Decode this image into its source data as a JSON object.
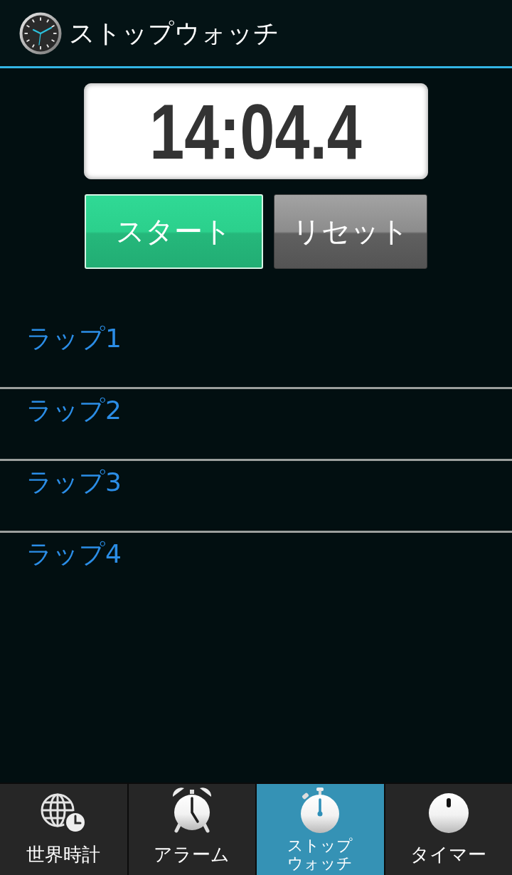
{
  "title_bar": {
    "title": "ストップウォッチ"
  },
  "stopwatch": {
    "time": "14:04.4"
  },
  "buttons": [
    {
      "label": "スタート",
      "kind": "start"
    },
    {
      "label": "リセット",
      "kind": "reset"
    }
  ],
  "laps": [
    {
      "label": "ラップ1"
    },
    {
      "label": "ラップ2"
    },
    {
      "label": "ラップ3"
    },
    {
      "label": "ラップ4"
    }
  ],
  "tabs": [
    {
      "label": "世界時計",
      "kind": "world_clock",
      "selected": false
    },
    {
      "label": "アラーム",
      "kind": "alarm",
      "selected": false
    },
    {
      "label": "ストップウォッチ",
      "kind": "stopwatch",
      "selected": true
    },
    {
      "label": "タイマー",
      "kind": "timer",
      "selected": false
    }
  ]
}
